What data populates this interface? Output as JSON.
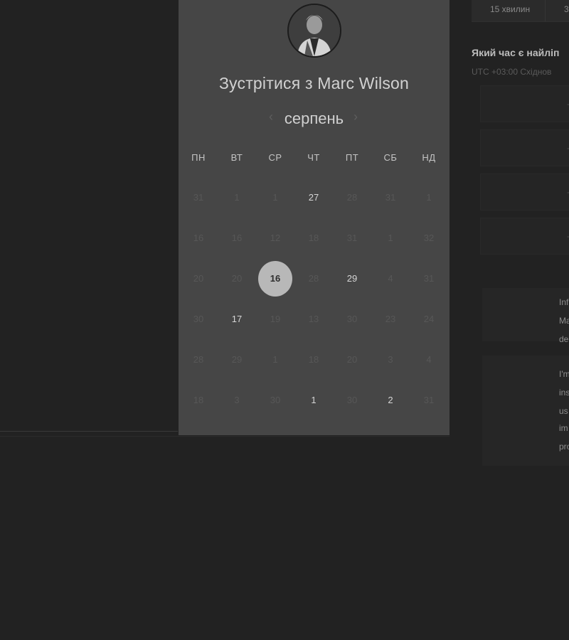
{
  "calendar": {
    "title": "Зустрітися з Marc Wilson",
    "month": "серпень",
    "prev_arrow": "‹",
    "next_arrow": "›",
    "weekdays": [
      "ПН",
      "ВТ",
      "СР",
      "ЧТ",
      "ПТ",
      "СБ",
      "НД"
    ],
    "weeks": [
      [
        {
          "label": "31",
          "state": "disabled"
        },
        {
          "label": "1",
          "state": "disabled"
        },
        {
          "label": "1",
          "state": "disabled"
        },
        {
          "label": "27",
          "state": "available"
        },
        {
          "label": "28",
          "state": "disabled"
        },
        {
          "label": "31",
          "state": "disabled"
        },
        {
          "label": "1",
          "state": "disabled"
        }
      ],
      [
        {
          "label": "16",
          "state": "disabled"
        },
        {
          "label": "16",
          "state": "disabled"
        },
        {
          "label": "12",
          "state": "disabled"
        },
        {
          "label": "18",
          "state": "disabled"
        },
        {
          "label": "31",
          "state": "disabled"
        },
        {
          "label": "1",
          "state": "disabled"
        },
        {
          "label": "32",
          "state": "disabled"
        }
      ],
      [
        {
          "label": "20",
          "state": "disabled"
        },
        {
          "label": "20",
          "state": "disabled"
        },
        {
          "label": "16",
          "state": "selected"
        },
        {
          "label": "28",
          "state": "disabled"
        },
        {
          "label": "29",
          "state": "available"
        },
        {
          "label": "4",
          "state": "disabled"
        },
        {
          "label": "31",
          "state": "disabled"
        }
      ],
      [
        {
          "label": "30",
          "state": "disabled"
        },
        {
          "label": "17",
          "state": "available"
        },
        {
          "label": "19",
          "state": "disabled"
        },
        {
          "label": "13",
          "state": "disabled"
        },
        {
          "label": "30",
          "state": "disabled"
        },
        {
          "label": "23",
          "state": "disabled"
        },
        {
          "label": "24",
          "state": "disabled"
        }
      ],
      [
        {
          "label": "28",
          "state": "disabled"
        },
        {
          "label": "29",
          "state": "disabled"
        },
        {
          "label": "1",
          "state": "disabled"
        },
        {
          "label": "18",
          "state": "disabled"
        },
        {
          "label": "20",
          "state": "disabled"
        },
        {
          "label": "3",
          "state": "disabled"
        },
        {
          "label": "4",
          "state": "disabled"
        }
      ],
      [
        {
          "label": "18",
          "state": "disabled"
        },
        {
          "label": "3",
          "state": "disabled"
        },
        {
          "label": "30",
          "state": "disabled"
        },
        {
          "label": "1",
          "state": "available"
        },
        {
          "label": "30",
          "state": "disabled"
        },
        {
          "label": "2",
          "state": "available"
        },
        {
          "label": "31",
          "state": "disabled"
        }
      ]
    ]
  },
  "duration": {
    "options": [
      "15 хвилин",
      "3"
    ]
  },
  "schedule": {
    "best_time_title": "Який час є найліп",
    "timezone": "UTC +03:00 Східнов",
    "slots": [
      "-",
      "-",
      "-",
      "-"
    ]
  },
  "description": {
    "lines1": [
      "Inf",
      "Ma",
      "de"
    ],
    "lines2": [
      "I'm",
      "ins",
      "us",
      "im",
      "pro"
    ]
  }
}
